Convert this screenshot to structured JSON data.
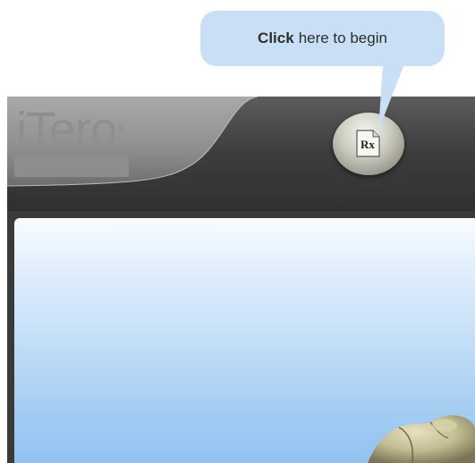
{
  "tooltip": {
    "bold_text": "Click",
    "text": "here to begin"
  },
  "header": {
    "logo_text": "iTero",
    "logo_mark": "®"
  },
  "rx_button": {
    "icon": "rx-document-icon",
    "label": "Rx"
  },
  "colors": {
    "tooltip_bg": "#c8dff5",
    "header_bg": "#3e3e3e",
    "content_gradient_top": "#fafdff",
    "content_gradient_bottom": "#90c2f0"
  }
}
